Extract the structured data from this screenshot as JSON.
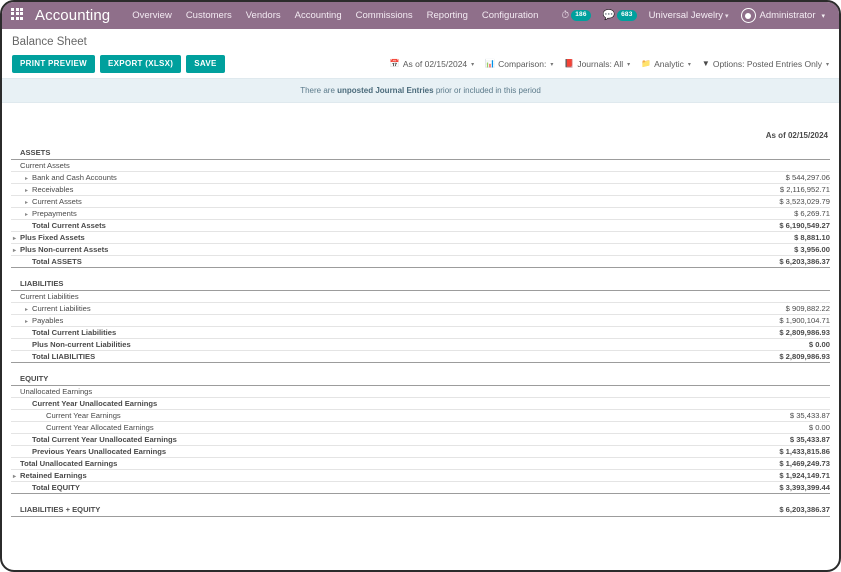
{
  "navbar": {
    "apps_icon": "apps-grid-icon",
    "brand": "Accounting",
    "items": [
      {
        "label": "Overview"
      },
      {
        "label": "Customers"
      },
      {
        "label": "Vendors"
      },
      {
        "label": "Accounting"
      },
      {
        "label": "Commissions"
      },
      {
        "label": "Reporting"
      },
      {
        "label": "Configuration"
      }
    ],
    "activity_icon": "clock-activity-icon",
    "activity_count": "186",
    "messages_icon": "chat-bubble-icon",
    "messages_count": "683",
    "company": "Universal Jewelry",
    "user": "Administrator",
    "caret": "▾",
    "accent": "#8f6f8a",
    "badge_color": "#00a09d"
  },
  "control_panel": {
    "title": "Balance Sheet",
    "buttons": [
      {
        "label": "PRINT PREVIEW",
        "name": "print-preview-button"
      },
      {
        "label": "EXPORT (XLSX)",
        "name": "export-xlsx-button"
      },
      {
        "label": "SAVE",
        "name": "save-button"
      }
    ],
    "filters": [
      {
        "icon": "calendar-icon",
        "glyph": "📅",
        "label": "As of 02/15/2024",
        "name": "date-filter"
      },
      {
        "icon": "chart-bar-icon",
        "glyph": "📊",
        "label": "Comparison:",
        "name": "comparison-filter"
      },
      {
        "icon": "book-icon",
        "glyph": "📕",
        "label": "Journals: All",
        "name": "journals-filter"
      },
      {
        "icon": "folder-icon",
        "glyph": "📁",
        "label": "Analytic",
        "name": "analytic-filter"
      },
      {
        "icon": "funnel-icon",
        "glyph": "▼",
        "label": "Options: Posted Entries Only",
        "name": "options-filter"
      }
    ],
    "caret": "▾",
    "button_color": "#00a09d"
  },
  "alert": {
    "prefix": "There are ",
    "strong": "unposted Journal Entries",
    "suffix": " prior or included in this period"
  },
  "report": {
    "as_of_label": "As of 02/15/2024",
    "rows": [
      {
        "label": "ASSETS",
        "amount": "",
        "indent": 0,
        "bold": true,
        "arrow": false,
        "style": "section",
        "name": "row-assets"
      },
      {
        "label": "Current Assets",
        "amount": "",
        "indent": 0,
        "bold": false,
        "arrow": false,
        "style": "group",
        "name": "row-current-assets-group"
      },
      {
        "label": "Bank and Cash Accounts",
        "amount": "$ 544,297.06",
        "indent": 1,
        "bold": false,
        "arrow": true,
        "style": "line",
        "name": "row-bank-and-cash-accounts"
      },
      {
        "label": "Receivables",
        "amount": "$ 2,116,952.71",
        "indent": 1,
        "bold": false,
        "arrow": true,
        "style": "line",
        "name": "row-receivables"
      },
      {
        "label": "Current Assets",
        "amount": "$ 3,523,029.79",
        "indent": 1,
        "bold": false,
        "arrow": true,
        "style": "line",
        "name": "row-current-assets"
      },
      {
        "label": "Prepayments",
        "amount": "$ 6,269.71",
        "indent": 1,
        "bold": false,
        "arrow": true,
        "style": "line",
        "name": "row-prepayments"
      },
      {
        "label": "Total Current Assets",
        "amount": "$ 6,190,549.27",
        "indent": 1,
        "bold": true,
        "arrow": false,
        "style": "total",
        "name": "row-total-current-assets"
      },
      {
        "label": "Plus Fixed Assets",
        "amount": "$ 8,881.10",
        "indent": 0,
        "bold": true,
        "arrow": true,
        "style": "line",
        "name": "row-plus-fixed-assets"
      },
      {
        "label": "Plus Non-current Assets",
        "amount": "$ 3,956.00",
        "indent": 0,
        "bold": true,
        "arrow": true,
        "style": "line",
        "name": "row-plus-non-current-assets"
      },
      {
        "label": "Total ASSETS",
        "amount": "$ 6,203,386.37",
        "indent": 1,
        "bold": true,
        "arrow": false,
        "style": "grand",
        "name": "row-total-assets"
      },
      {
        "label": "",
        "amount": "",
        "indent": 0,
        "bold": false,
        "arrow": false,
        "style": "gap",
        "name": "row-gap-1"
      },
      {
        "label": "LIABILITIES",
        "amount": "",
        "indent": 0,
        "bold": true,
        "arrow": false,
        "style": "section",
        "name": "row-liabilities"
      },
      {
        "label": "Current Liabilities",
        "amount": "",
        "indent": 0,
        "bold": false,
        "arrow": false,
        "style": "group",
        "name": "row-current-liabilities-group"
      },
      {
        "label": "Current Liabilities",
        "amount": "$ 909,882.22",
        "indent": 1,
        "bold": false,
        "arrow": true,
        "style": "line",
        "name": "row-current-liabilities"
      },
      {
        "label": "Payables",
        "amount": "$ 1,900,104.71",
        "indent": 1,
        "bold": false,
        "arrow": true,
        "style": "line",
        "name": "row-payables"
      },
      {
        "label": "Total Current Liabilities",
        "amount": "$ 2,809,986.93",
        "indent": 1,
        "bold": true,
        "arrow": false,
        "style": "total",
        "name": "row-total-current-liabilities"
      },
      {
        "label": "Plus Non-current Liabilities",
        "amount": "$ 0.00",
        "indent": 1,
        "bold": true,
        "arrow": false,
        "style": "line",
        "name": "row-plus-non-current-liabilities"
      },
      {
        "label": "Total LIABILITIES",
        "amount": "$ 2,809,986.93",
        "indent": 1,
        "bold": true,
        "arrow": false,
        "style": "grand",
        "name": "row-total-liabilities"
      },
      {
        "label": "",
        "amount": "",
        "indent": 0,
        "bold": false,
        "arrow": false,
        "style": "gap",
        "name": "row-gap-2"
      },
      {
        "label": "EQUITY",
        "amount": "",
        "indent": 0,
        "bold": true,
        "arrow": false,
        "style": "section",
        "name": "row-equity"
      },
      {
        "label": "Unallocated Earnings",
        "amount": "",
        "indent": 0,
        "bold": false,
        "arrow": false,
        "style": "group",
        "name": "row-unallocated-earnings-group"
      },
      {
        "label": "Current Year Unallocated Earnings",
        "amount": "",
        "indent": 1,
        "bold": true,
        "arrow": false,
        "style": "line",
        "name": "row-current-year-unallocated-earnings-group"
      },
      {
        "label": "Current Year Earnings",
        "amount": "$ 35,433.87",
        "indent": 2,
        "bold": false,
        "arrow": false,
        "style": "line-muted",
        "name": "row-current-year-earnings"
      },
      {
        "label": "Current Year Allocated Earnings",
        "amount": "$ 0.00",
        "indent": 2,
        "bold": false,
        "arrow": false,
        "style": "line-muted",
        "name": "row-current-year-allocated-earnings"
      },
      {
        "label": "Total Current Year Unallocated Earnings",
        "amount": "$ 35,433.87",
        "indent": 1,
        "bold": true,
        "arrow": false,
        "style": "total",
        "name": "row-total-current-year-unallocated-earnings"
      },
      {
        "label": "Previous Years Unallocated Earnings",
        "amount": "$ 1,433,815.86",
        "indent": 1,
        "bold": true,
        "arrow": false,
        "style": "line",
        "name": "row-previous-years-unallocated-earnings"
      },
      {
        "label": "Total Unallocated Earnings",
        "amount": "$ 1,469,249.73",
        "indent": 0,
        "bold": true,
        "arrow": false,
        "style": "total",
        "name": "row-total-unallocated-earnings"
      },
      {
        "label": "Retained Earnings",
        "amount": "$ 1,924,149.71",
        "indent": 0,
        "bold": true,
        "arrow": true,
        "style": "line",
        "name": "row-retained-earnings"
      },
      {
        "label": "Total EQUITY",
        "amount": "$ 3,393,399.44",
        "indent": 1,
        "bold": true,
        "arrow": false,
        "style": "grand",
        "name": "row-total-equity"
      },
      {
        "label": "",
        "amount": "",
        "indent": 0,
        "bold": false,
        "arrow": false,
        "style": "gap",
        "name": "row-gap-3"
      },
      {
        "label": "LIABILITIES + EQUITY",
        "amount": "$ 6,203,386.37",
        "indent": 0,
        "bold": true,
        "arrow": false,
        "style": "grand",
        "name": "row-liabilities-plus-equity"
      }
    ],
    "arrow_glyph": "▸"
  }
}
